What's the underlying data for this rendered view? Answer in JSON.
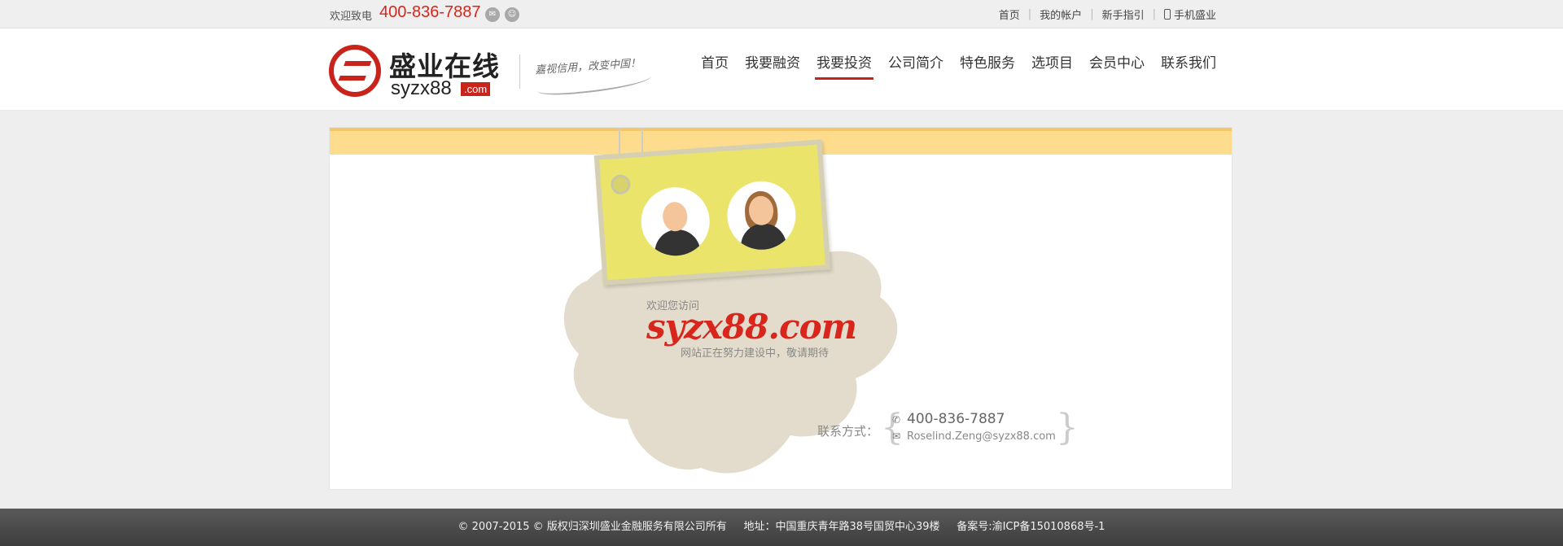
{
  "topbar": {
    "welcome": "欢迎致电",
    "phone": "400-836-7887",
    "icons": [
      "wechat-icon",
      "qq-icon"
    ],
    "links": [
      "首页",
      "我的帐户",
      "新手指引",
      "手机盛业"
    ]
  },
  "header": {
    "logo_cn": "盛业在线",
    "logo_en": "syzx88",
    "logo_com": ".com",
    "slogan": "嘉视信用，改变中国！",
    "nav": [
      "首页",
      "我要融资",
      "我要投资",
      "公司简介",
      "特色服务",
      "选项目",
      "会员中心",
      "联系我们"
    ],
    "active_nav": "我要投资"
  },
  "main": {
    "welcome": "欢迎您访问",
    "brand": "syzx88.com",
    "sub": "网站正在努力建设中，敬请期待",
    "contact_label": "联系方式：",
    "contact_phone": "400-836-7887",
    "contact_email": "Roselind.Zeng@syzx88.com"
  },
  "footer": {
    "text": "© 2007-2015 © 版权归深圳盛业金融服务有限公司所有     地址：中国重庆青年路38号国贸中心39楼     备案号:渝ICP备15010868号-1"
  },
  "colors": {
    "brand_red": "#d9261c",
    "band_yellow": "#fddc8e",
    "tag_yellow": "#eae46a",
    "cloud_beige": "#e3dccc"
  }
}
